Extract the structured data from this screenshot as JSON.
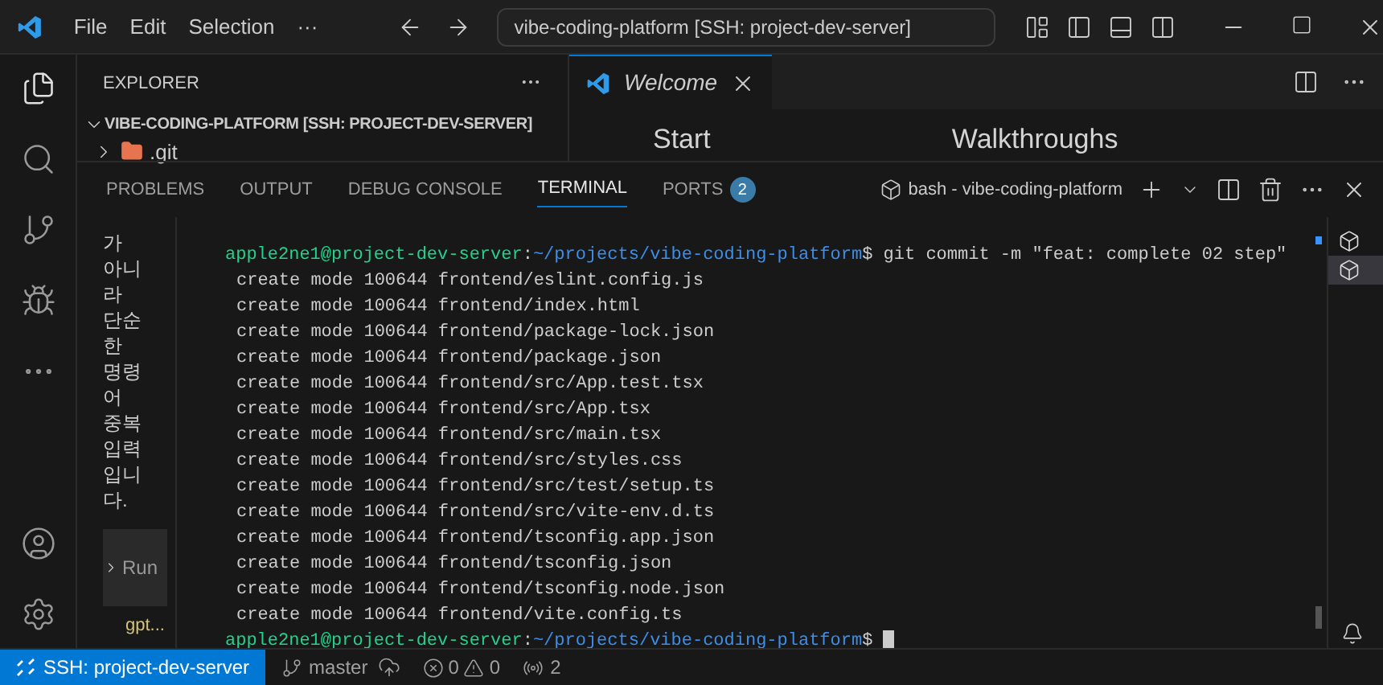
{
  "title_bar": {
    "menu": [
      "File",
      "Edit",
      "Selection",
      "···"
    ],
    "command_center": "vibe-coding-platform [SSH: project-dev-server]"
  },
  "explorer": {
    "title": "EXPLORER",
    "root": {
      "label": "VIBE-CODING-PLATFORM [SSH: PROJECT-DEV-SERVER]",
      "expanded": true
    },
    "items": [
      {
        "label": ".git",
        "expanded": false
      }
    ]
  },
  "editor": {
    "tabs": [
      {
        "label": "Welcome",
        "selected": true
      }
    ],
    "headings": [
      "Start",
      "Walkthroughs"
    ]
  },
  "panel": {
    "tabs": [
      {
        "label": "PROBLEMS",
        "selected": false
      },
      {
        "label": "OUTPUT",
        "selected": false
      },
      {
        "label": "DEBUG CONSOLE",
        "selected": false
      },
      {
        "label": "TERMINAL",
        "selected": true
      },
      {
        "label": "PORTS",
        "selected": false,
        "badge": "2"
      }
    ],
    "terminal_name": "bash - vibe-coding-platform"
  },
  "chat": {
    "text": "가 아니라 단순한 명령어 중복 입력입니다.",
    "item": {
      "label": "Run",
      "expanded": false
    },
    "footer": "gpt..."
  },
  "terminal": {
    "lines": [
      {
        "kind": "prompt",
        "user": "apple2ne1@project-dev-server",
        "sep": ":",
        "path": "~/projects/vibe-coding-platform",
        "symbol": "$",
        "command": "git commit -m \"feat: complete 02 step\""
      },
      {
        "kind": "output",
        "text": "create mode 100644 frontend/eslint.config.js"
      },
      {
        "kind": "output",
        "text": "create mode 100644 frontend/index.html"
      },
      {
        "kind": "output",
        "text": "create mode 100644 frontend/package-lock.json"
      },
      {
        "kind": "output",
        "text": "create mode 100644 frontend/package.json"
      },
      {
        "kind": "output",
        "text": "create mode 100644 frontend/src/App.test.tsx"
      },
      {
        "kind": "output",
        "text": "create mode 100644 frontend/src/App.tsx"
      },
      {
        "kind": "output",
        "text": "create mode 100644 frontend/src/main.tsx"
      },
      {
        "kind": "output",
        "text": "create mode 100644 frontend/src/styles.css"
      },
      {
        "kind": "output",
        "text": "create mode 100644 frontend/src/test/setup.ts"
      },
      {
        "kind": "output",
        "text": "create mode 100644 frontend/src/vite-env.d.ts"
      },
      {
        "kind": "output",
        "text": "create mode 100644 frontend/tsconfig.app.json"
      },
      {
        "kind": "output",
        "text": "create mode 100644 frontend/tsconfig.json"
      },
      {
        "kind": "output",
        "text": "create mode 100644 frontend/tsconfig.node.json"
      },
      {
        "kind": "output",
        "text": "create mode 100644 frontend/vite.config.ts"
      },
      {
        "kind": "prompt",
        "user": "apple2ne1@project-dev-server",
        "sep": ":",
        "path": "~/projects/vibe-coding-platform",
        "symbol": "$",
        "cursor": true
      }
    ],
    "tabs": [
      {
        "selected": false
      },
      {
        "selected": true
      }
    ]
  },
  "status_bar": {
    "remote": "SSH: project-dev-server",
    "branch": "master",
    "errors": "0",
    "warnings": "0",
    "ports": "2"
  }
}
